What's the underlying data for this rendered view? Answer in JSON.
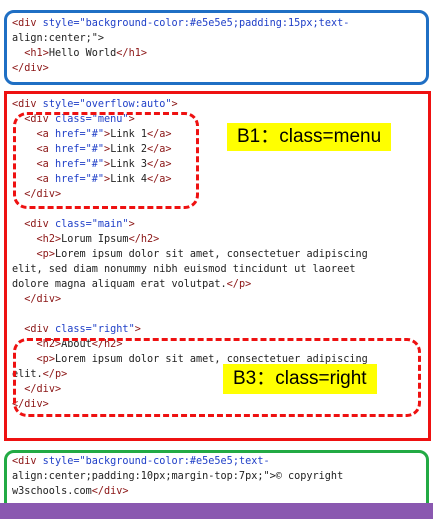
{
  "callouts": {
    "b1": "B1：class=menu",
    "b3": "B3：class=right"
  },
  "code": {
    "header": [
      "<div style=\"background-color:#e5e5e5;padding:15px;text-",
      "align:center;\">",
      "  <h1>Hello World</h1>",
      "</div>"
    ],
    "container": [
      "<div style=\"overflow:auto\">",
      "  <div class=\"menu\">",
      "    <a href=\"#\">Link 1</a>",
      "    <a href=\"#\">Link 2</a>",
      "    <a href=\"#\">Link 3</a>",
      "    <a href=\"#\">Link 4</a>",
      "  </div>",
      "",
      "  <div class=\"main\">",
      "    <h2>Lorum Ipsum</h2>",
      "    <p>Lorem ipsum dolor sit amet, consectetuer adipiscing",
      "elit, sed diam nonummy nibh euismod tincidunt ut laoreet",
      "dolore magna aliquam erat volutpat.</p>",
      "  </div>",
      "",
      "  <div class=\"right\">",
      "    <h2>About</h2>",
      "    <p>Lorem ipsum dolor sit amet, consectetuer adipiscing",
      "elit.</p>",
      "  </div>",
      "</div>"
    ],
    "footer": [
      "<div style=\"background-color:#e5e5e5;text-",
      "align:center;padding:10px;margin-top:7px;\">© copyright",
      "w3schools.com</div>"
    ]
  },
  "colors": {
    "header_box": "#1f6fc4",
    "container_box": "#ee1111",
    "footer_box": "#22aa44",
    "callout_bg": "#ffff00",
    "bottom_bar": "#8a58b0"
  }
}
